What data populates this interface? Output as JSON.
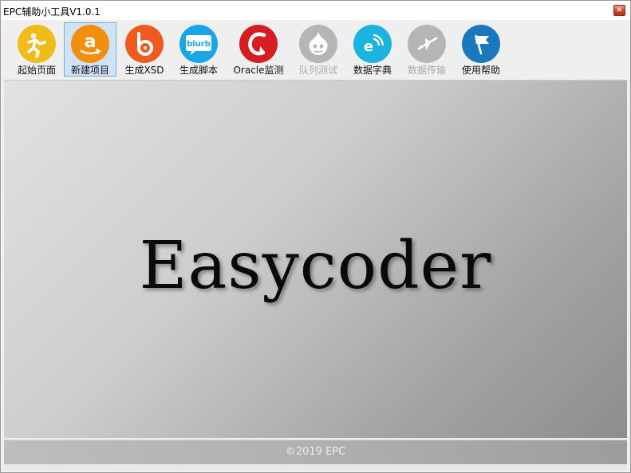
{
  "window": {
    "title": "EPC辅助小工具V1.0.1",
    "close_glyph": "×"
  },
  "toolbar": {
    "items": [
      {
        "label": "起始页面",
        "icon": "runner-icon",
        "color": "#f0bc1a",
        "enabled": true,
        "selected": false
      },
      {
        "label": "新建项目",
        "icon": "amazon-icon",
        "color": "#f0900e",
        "enabled": true,
        "selected": true
      },
      {
        "label": "生成XSD",
        "icon": "bebo-icon",
        "color": "#ef5a1e",
        "enabled": true,
        "selected": false
      },
      {
        "label": "生成脚本",
        "icon": "blurb-icon",
        "color": "#1aa5e6",
        "enabled": true,
        "selected": false
      },
      {
        "label": "Oracle监测",
        "icon": "oracle-icon",
        "color": "#d51e22",
        "enabled": true,
        "selected": false
      },
      {
        "label": "队列测试",
        "icon": "drupal-icon",
        "color": "#b5b5b5",
        "enabled": false,
        "selected": false
      },
      {
        "label": "数据字典",
        "icon": "signal-e-icon",
        "color": "#1bb4de",
        "enabled": true,
        "selected": false
      },
      {
        "label": "数据传输",
        "icon": "plane-icon",
        "color": "#b5b5b5",
        "enabled": false,
        "selected": false
      },
      {
        "label": "使用帮助",
        "icon": "flag-icon",
        "color": "#1b78bd",
        "enabled": true,
        "selected": false
      }
    ]
  },
  "main": {
    "brand": "Easycoder"
  },
  "footer": {
    "copyright": "©2019 EPC"
  }
}
